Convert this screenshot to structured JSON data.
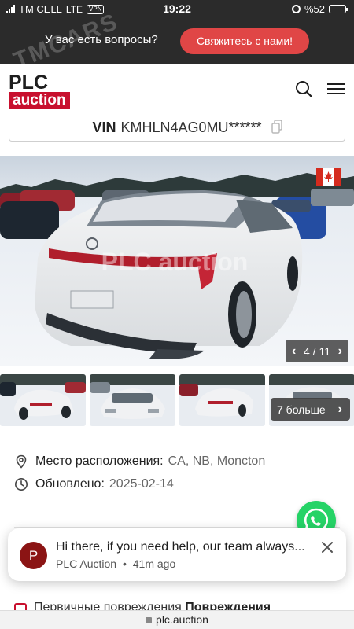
{
  "status_bar": {
    "carrier": "TM CELL",
    "network": "LTE",
    "vpn": "VPN",
    "time": "19:22",
    "battery": "%52",
    "battery_level": 0.52
  },
  "banner": {
    "watermark": "TMCARS",
    "question": "У вас есть вопросы?",
    "contact_button": "Свяжитесь с нами!"
  },
  "header": {
    "logo_top": "PLC",
    "logo_bottom": "auction"
  },
  "vin": {
    "label": "VIN",
    "value": "KMHLN4AG0MU******"
  },
  "gallery": {
    "counter": "4 / 11",
    "more": "7 больше",
    "watermark": "PLC auction",
    "flag": "canada-flag-icon"
  },
  "info": {
    "location_label": "Место расположения:",
    "location_value": "CA, NB, Moncton",
    "updated_label": "Обновлено:",
    "updated_value": "2025-02-14"
  },
  "chat": {
    "avatar": "P",
    "message": "Hi there, if you need help, our team always...",
    "sender": "PLC Auction",
    "separator": "•",
    "time": "41m ago"
  },
  "damage": {
    "label": "Первичные повреждения",
    "value": "Повреждения"
  },
  "url_bar": {
    "url": "plc.auction"
  },
  "colors": {
    "brand_red": "#c8102e",
    "contact_button": "#e04646",
    "banner_bg": "#2b2b2b",
    "whatsapp": "#25d366"
  }
}
